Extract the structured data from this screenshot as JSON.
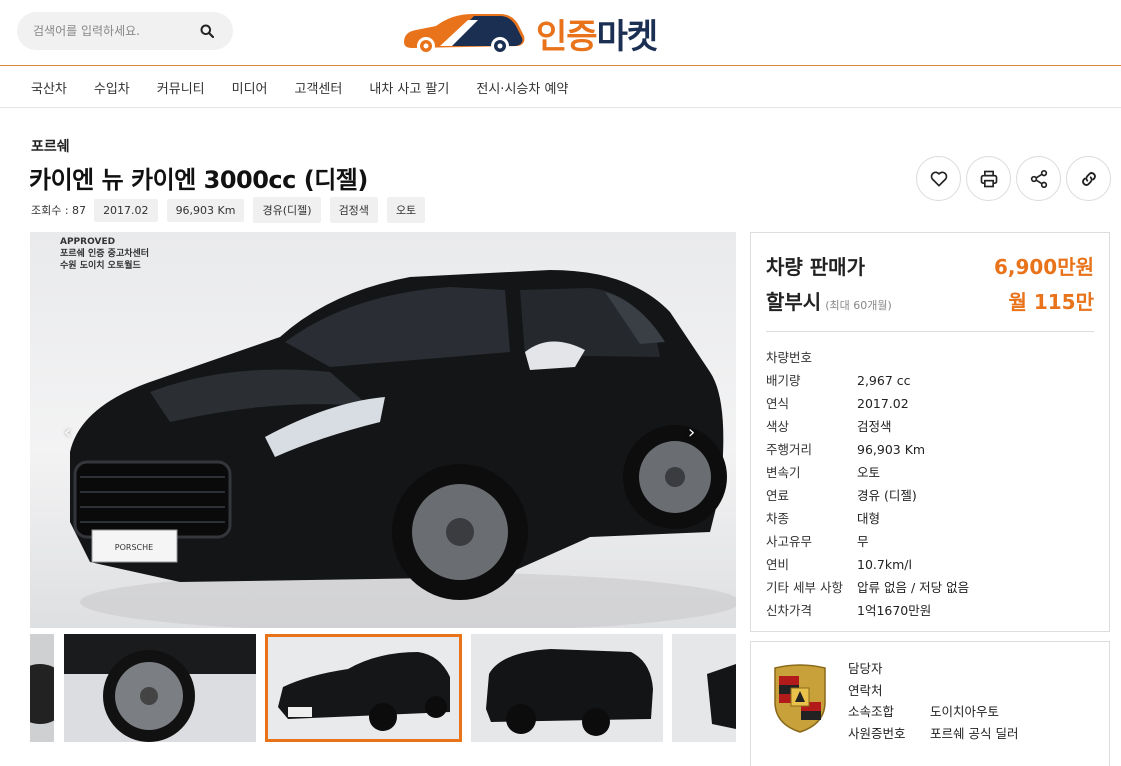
{
  "search": {
    "placeholder": "검색어를 입력하세요."
  },
  "logo": {
    "part1": "인증",
    "part2": "마켓"
  },
  "nav": [
    "국산차",
    "수입차",
    "커뮤니티",
    "미디어",
    "고객센터",
    "내차 사고 팔기",
    "전시·시승차 예약"
  ],
  "listing": {
    "brand": "포르쉐",
    "title": "카이엔 뉴 카이엔 3000cc (디젤)",
    "views": "조회수 : 87",
    "tags": [
      "2017.02",
      "96,903 Km",
      "경유(디젤)",
      "검정색",
      "오토"
    ]
  },
  "image": {
    "caption_line1": "APPROVED",
    "caption_line2": "포르쉐 인증 중고차센터",
    "caption_line3": "수원 도이치 오토월드",
    "plate_text": "PORSCHE"
  },
  "price": {
    "sale_label": "차량 판매가",
    "sale_value": "6,900만원",
    "installment_label": "할부시",
    "installment_sub": "(최대 60개월)",
    "installment_value": "월 115만"
  },
  "specs": [
    {
      "k": "차량번호",
      "v": ""
    },
    {
      "k": "배기량",
      "v": "2,967 cc"
    },
    {
      "k": "연식",
      "v": "2017.02"
    },
    {
      "k": "색상",
      "v": "검정색"
    },
    {
      "k": "주행거리",
      "v": "96,903 Km"
    },
    {
      "k": "변속기",
      "v": "오토"
    },
    {
      "k": "연료",
      "v": "경유 (디젤)"
    },
    {
      "k": "차종",
      "v": "대형"
    },
    {
      "k": "사고유무",
      "v": "무"
    },
    {
      "k": "연비",
      "v": "10.7km/l"
    },
    {
      "k": "기타 세부 사항",
      "v": "압류 없음 / 저당 없음"
    },
    {
      "k": "신차가격",
      "v": "1억1670만원"
    }
  ],
  "dealer": [
    {
      "k": "담당자",
      "v": ""
    },
    {
      "k": "연락처",
      "v": ""
    },
    {
      "k": "소속조합",
      "v": "도이치아우토"
    },
    {
      "k": "사원증번호",
      "v": "포르쉐 공식 딜러"
    }
  ],
  "colors": {
    "accent": "#e8731a",
    "navy": "#1b2f53"
  }
}
